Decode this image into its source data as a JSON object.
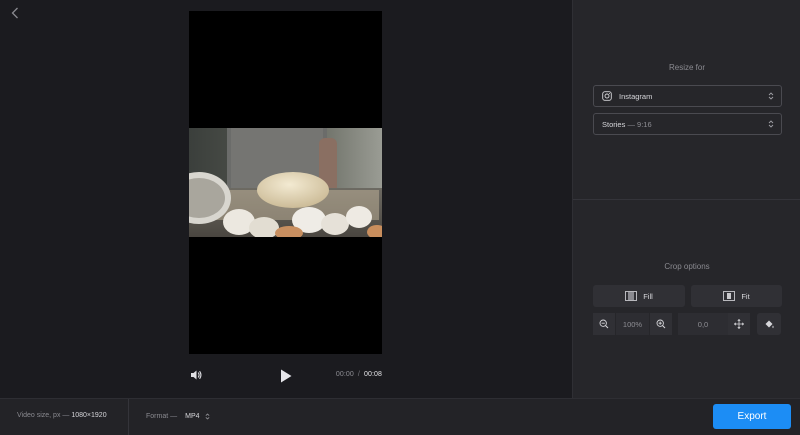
{
  "player": {
    "time_current": "00:00",
    "time_separator": "/",
    "time_duration": "00:08"
  },
  "sidebar": {
    "resize_title": "Resize for",
    "platform": "Instagram",
    "preset_label": "Stories",
    "preset_ratio": "— 9:16",
    "crop_title": "Crop options",
    "fill_label": "Fill",
    "fit_label": "Fit",
    "zoom_value": "100%",
    "position_value": "0,0"
  },
  "bottombar": {
    "video_size_label": "Video size, px —",
    "video_size_value": "1080×1920",
    "format_label": "Format —",
    "format_value": "MP4",
    "export_label": "Export"
  },
  "colors": {
    "accent": "#1c8df5",
    "background": "#1b1b1f",
    "panel": "#26262a"
  },
  "icons": [
    "back-arrow-icon",
    "volume-icon",
    "play-icon",
    "instagram-icon",
    "chevron-updown-icon",
    "fill-icon",
    "fit-icon",
    "zoom-out-icon",
    "zoom-in-icon",
    "move-icon",
    "paint-bucket-icon"
  ]
}
